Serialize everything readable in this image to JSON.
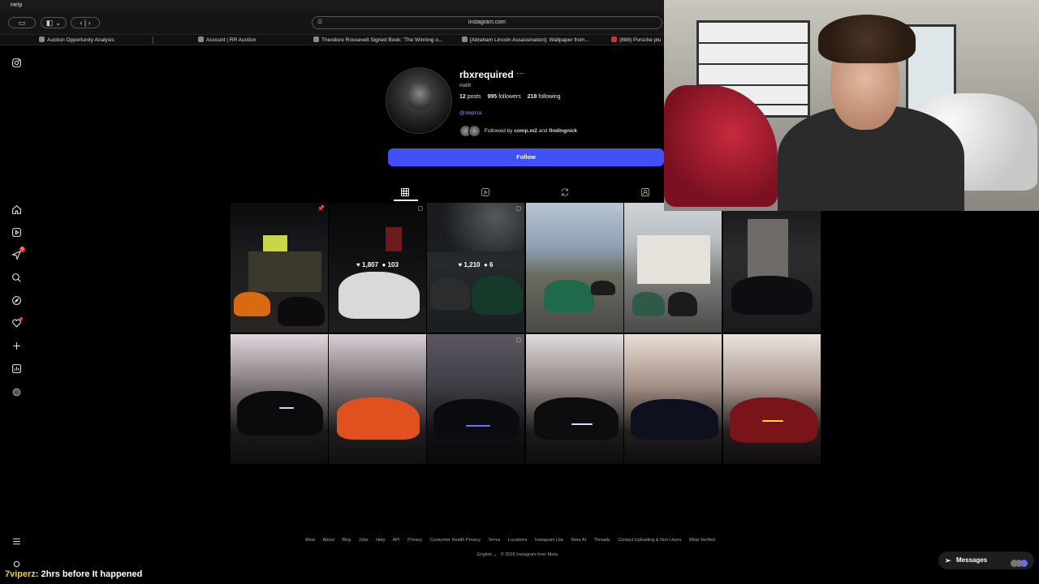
{
  "menubar": {
    "help": "Help"
  },
  "browser": {
    "url": "instagram.com",
    "tabs": [
      {
        "label": "Auction Opportunity Analysis"
      },
      {
        "label": "Account | RR Auction"
      },
      {
        "label": "Theodore Roosevelt Signed Book: 'The Winning o..."
      },
      {
        "label": "[Abraham Lincoln Assassination]: Wallpaper from..."
      },
      {
        "label": "(888) Porsche plu"
      }
    ]
  },
  "nav": {
    "notifications_badge": "6",
    "icons": [
      "instagram-icon",
      "home-icon",
      "reels-icon",
      "messages-icon",
      "search-icon",
      "explore-icon",
      "notifications-icon",
      "create-icon",
      "dashboard-icon",
      "profile-icon",
      "menu-icon",
      "threads-icon"
    ]
  },
  "profile": {
    "username": "rbxrequired",
    "more": "···",
    "bio": "not/it",
    "posts_count": "12",
    "posts_label": "posts",
    "followers_count": "995",
    "followers_label": "followers",
    "following_count": "218",
    "following_label": "following",
    "link": "@slept.la",
    "followed_by_prefix": "Followed by",
    "followed_by_users": "comp.m2",
    "followed_by_and": "and",
    "followed_by_user2": "findingnick",
    "follow_label": "Follow"
  },
  "posts": [
    {
      "likes": "",
      "comments": "",
      "pinned": true
    },
    {
      "likes": "1,807",
      "comments": "103"
    },
    {
      "likes": "1,210",
      "comments": "6"
    },
    {
      "likes": "",
      "comments": ""
    },
    {
      "likes": "",
      "comments": ""
    },
    {
      "likes": "",
      "comments": ""
    },
    {
      "likes": "",
      "comments": ""
    },
    {
      "likes": "",
      "comments": ""
    },
    {
      "likes": "",
      "comments": ""
    },
    {
      "likes": "",
      "comments": ""
    },
    {
      "likes": "",
      "comments": ""
    },
    {
      "likes": "",
      "comments": ""
    }
  ],
  "footer": {
    "links": [
      "Meta",
      "About",
      "Blog",
      "Jobs",
      "Help",
      "API",
      "Privacy",
      "Consumer Health Privacy",
      "Terms",
      "Locations",
      "Instagram Lite",
      "Meta AI",
      "Threads",
      "Contact Uploading & Non-Users",
      "Meta Verified"
    ],
    "language": "English",
    "copyright": "© 2026 Instagram from Meta"
  },
  "messages": {
    "label": "Messages"
  },
  "caption": {
    "user": "7viperz",
    "text": ": 2hrs before It happened"
  }
}
